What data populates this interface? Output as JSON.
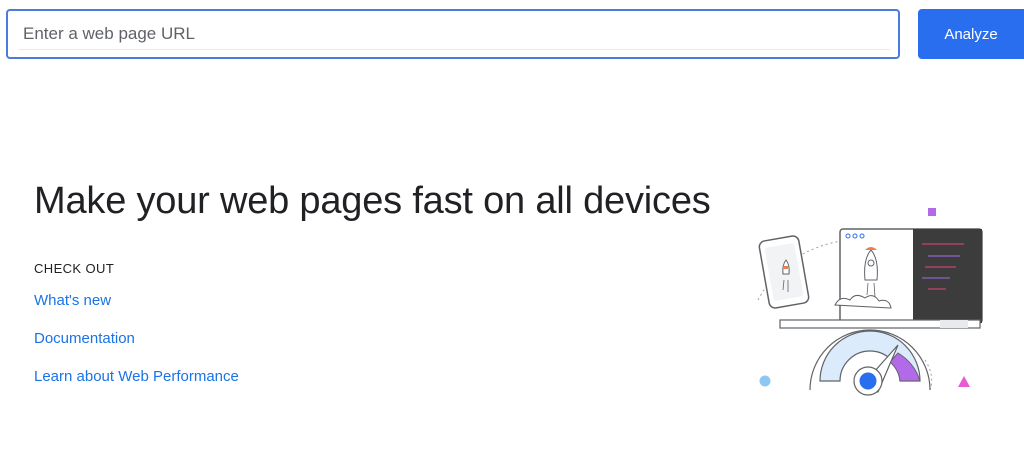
{
  "search": {
    "placeholder": "Enter a web page URL",
    "value": "",
    "button_label": "Analyze"
  },
  "hero": {
    "title": "Make your web pages fast on all devices"
  },
  "checkout": {
    "heading": "CHECK OUT",
    "links": [
      {
        "label": "What's new"
      },
      {
        "label": "Documentation"
      },
      {
        "label": "Learn about Web Performance"
      }
    ]
  },
  "illustration": {
    "name": "speed-devices-illustration",
    "colors": {
      "accent_blue": "#2a6ef0",
      "purple": "#b36ae8",
      "pink": "#e85bd4",
      "light_blue": "#8ec8f0",
      "gauge_fill": "#dcebfb",
      "rocket_orange": "#f07b4e",
      "code_pink": "#e8437a",
      "code_purple": "#a56ae8",
      "terminal_bg": "#3c3c3c"
    }
  }
}
